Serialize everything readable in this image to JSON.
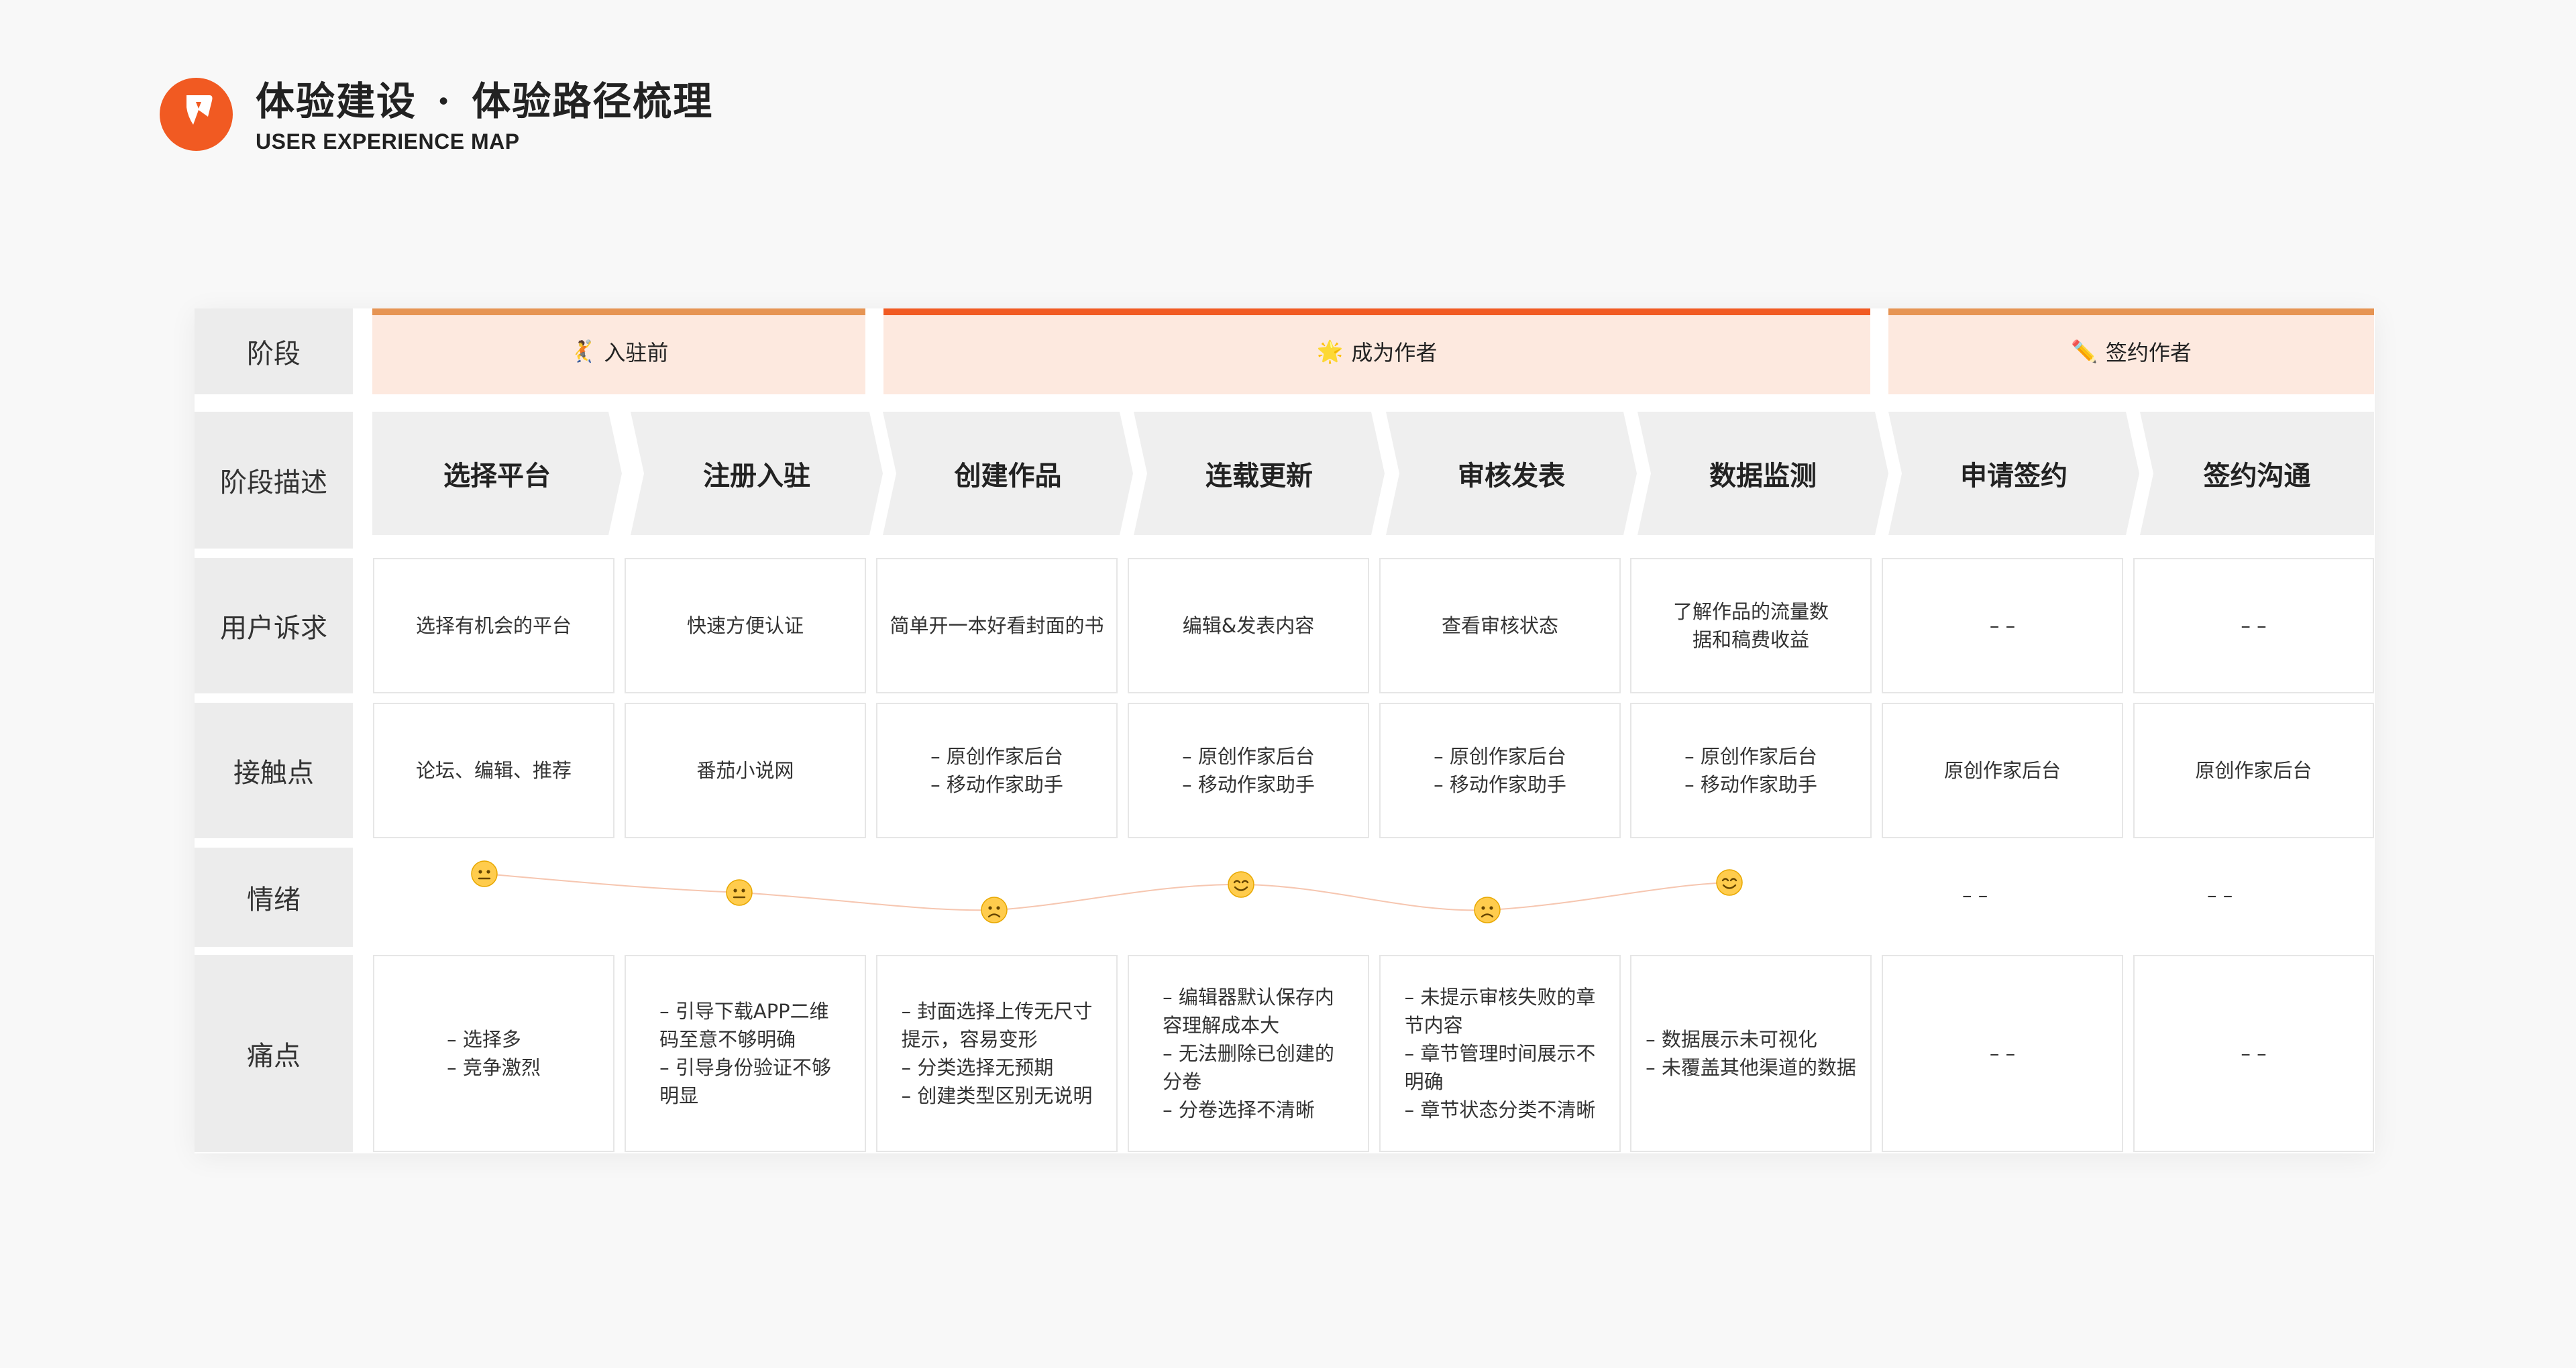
{
  "header": {
    "title_left": "体验建设",
    "title_sep": "·",
    "title_right": "体验路径梳理",
    "subtitle": "USER EXPERIENCE MAP"
  },
  "colors": {
    "brand": "#f15a22",
    "stage_fill": "#fde9df",
    "stage_bar_soft": "#e69453",
    "stage_bar_strong": "#f15a22",
    "row_label_bg": "#ececec",
    "step_bg": "#efefef"
  },
  "row_labels": {
    "stage": "阶段",
    "description": "阶段描述",
    "user_needs": "用户诉求",
    "touchpoints": "接触点",
    "emotion": "情绪",
    "pain_points": "痛点"
  },
  "stages": [
    {
      "icon": "🤾",
      "label": "入驻前"
    },
    {
      "icon": "🌟",
      "label": "成为作者"
    },
    {
      "icon": "✏️",
      "label": "签约作者"
    }
  ],
  "steps": [
    "选择平台",
    "注册入驻",
    "创建作品",
    "连载更新",
    "审核发表",
    "数据监测",
    "申请签约",
    "签约沟通"
  ],
  "user_needs": [
    [
      "选择有机会的平台"
    ],
    [
      "快速方便认证"
    ],
    [
      "简单开一本好看封面的书"
    ],
    [
      "编辑&发表内容"
    ],
    [
      "查看审核状态"
    ],
    [
      "了解作品的流量数",
      "据和稿费收益"
    ],
    [
      "– –"
    ],
    [
      "– –"
    ]
  ],
  "touchpoints": [
    [
      "论坛、编辑、推荐"
    ],
    [
      "番茄小说网"
    ],
    [
      "– 原创作家后台",
      "– 移动作家助手"
    ],
    [
      "– 原创作家后台",
      "– 移动作家助手"
    ],
    [
      "– 原创作家后台",
      "– 移动作家助手"
    ],
    [
      "– 原创作家后台",
      "– 移动作家助手"
    ],
    [
      "原创作家后台"
    ],
    [
      "原创作家后台"
    ]
  ],
  "emotion": {
    "faces": [
      {
        "icon": "neutral-face"
      },
      {
        "icon": "neutral-face"
      },
      {
        "icon": "slightly-frowning-face"
      },
      {
        "icon": "smiling-face"
      },
      {
        "icon": "slightly-frowning-face"
      },
      {
        "icon": "smiling-face"
      }
    ],
    "empty": [
      "– –",
      "– –"
    ]
  },
  "pain_points": [
    [
      "– 选择多",
      "– 竞争激烈"
    ],
    [
      "– 引导下载APP二维",
      "码至意不够明确",
      "– 引导身份验证不够",
      "明显"
    ],
    [
      "– 封面选择上传无尺寸",
      "提示，容易变形",
      "– 分类选择无预期",
      "– 创建类型区别无说明"
    ],
    [
      "– 编辑器默认保存内",
      "容理解成本大",
      "– 无法删除已创建的",
      "分卷",
      "– 分卷选择不清晰"
    ],
    [
      "– 未提示审核失败的章",
      "节内容",
      "– 章节管理时间展示不",
      "明确",
      "– 章节状态分类不清晰"
    ],
    [
      "– 数据展示未可视化",
      "– 未覆盖其他渠道的数据"
    ],
    [
      "– –"
    ],
    [
      "– –"
    ]
  ]
}
